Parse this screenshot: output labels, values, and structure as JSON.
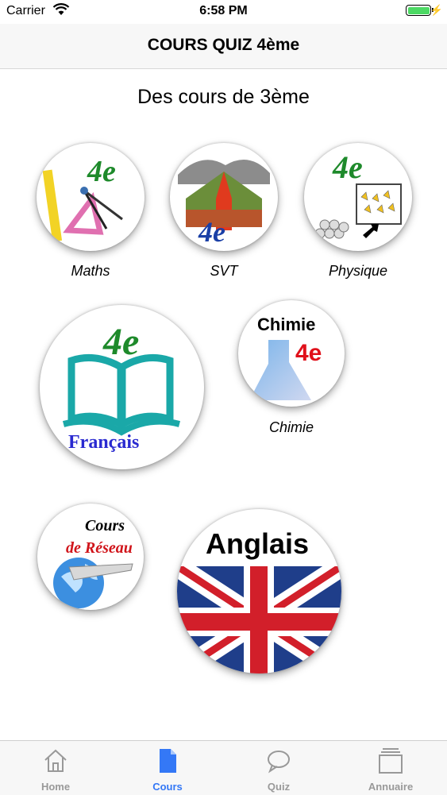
{
  "status_bar": {
    "carrier": "Carrier",
    "time": "6:58 PM"
  },
  "nav": {
    "title": "COURS QUIZ 4ème"
  },
  "section_title": "Des cours de 3ème",
  "courses": [
    {
      "caption": "Maths",
      "badge": "4e"
    },
    {
      "caption": "SVT",
      "badge": "4e"
    },
    {
      "caption": "Physique",
      "badge": "4e"
    },
    {
      "caption": "",
      "badge": "4e",
      "logo_text": "Français"
    },
    {
      "caption": "Chimie",
      "badge": "4e",
      "logo_text": "Chimie"
    },
    {
      "caption": "",
      "logo_text_1": "Cours",
      "logo_text_2": "de Réseau"
    },
    {
      "caption": "",
      "logo_text": "Anglais"
    }
  ],
  "tabs": [
    {
      "label": "Home",
      "icon": "home-icon",
      "active": false
    },
    {
      "label": "Cours",
      "icon": "document-icon",
      "active": true
    },
    {
      "label": "Quiz",
      "icon": "chat-bubble-icon",
      "active": false
    },
    {
      "label": "Annuaire",
      "icon": "folder-icon",
      "active": false
    }
  ],
  "colors": {
    "accent": "#3478f6",
    "inactive_tab": "#999999",
    "battery": "#4cd964"
  }
}
